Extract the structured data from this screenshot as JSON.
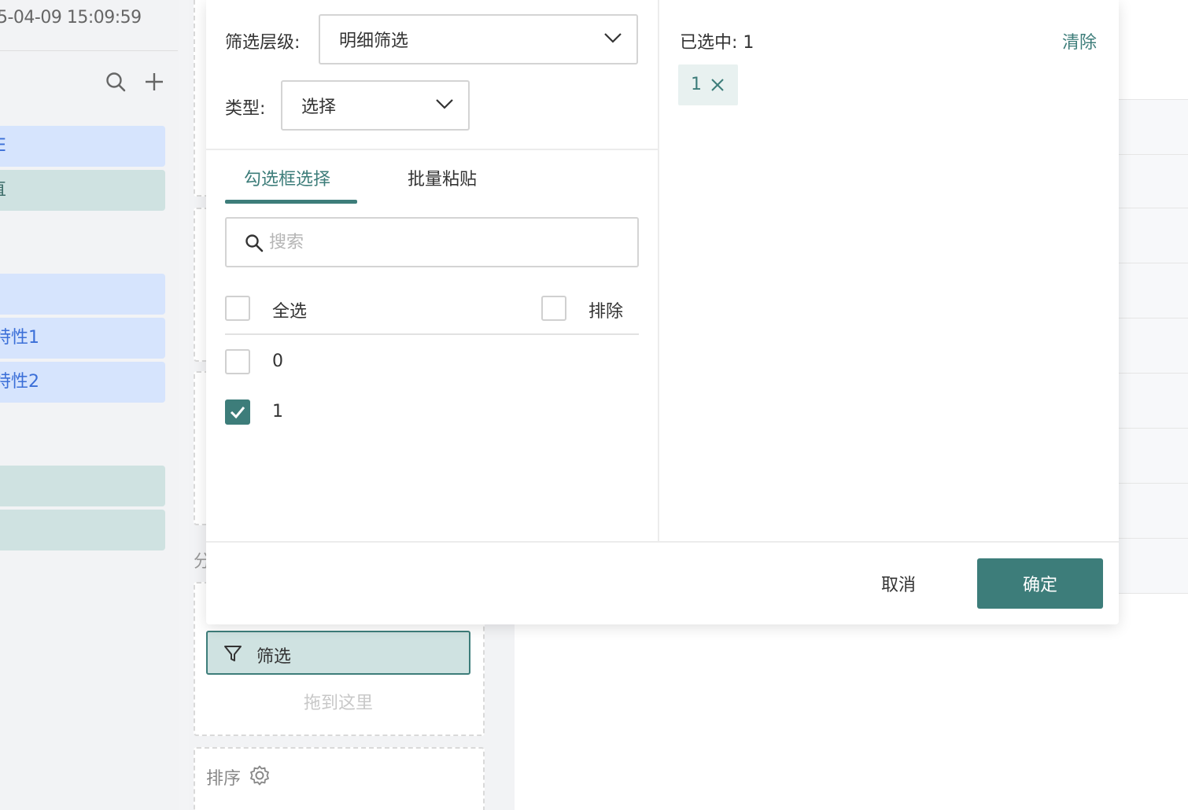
{
  "left_panel": {
    "timestamp": "5-04-09 15:09:59",
    "fields": [
      {
        "label": "E",
        "style": "blue"
      },
      {
        "label": "直",
        "style": "teal"
      },
      {
        "label": "",
        "style": "blue"
      },
      {
        "label": "特性1",
        "style": "blue"
      },
      {
        "label": "特性2",
        "style": "blue"
      },
      {
        "label": "",
        "style": "teal"
      },
      {
        "label": "",
        "style": "teal"
      }
    ]
  },
  "config": {
    "section_label": "分",
    "filter_chip_label": "筛选",
    "drop_hint": "拖到这里",
    "sort_label": "排序"
  },
  "modal": {
    "level_label": "筛选层级:",
    "level_value": "明细筛选",
    "type_label": "类型:",
    "type_value": "选择",
    "tabs": [
      {
        "label": "勾选框选择",
        "active": true
      },
      {
        "label": "批量粘贴",
        "active": false
      }
    ],
    "search_placeholder": "搜索",
    "select_all_label": "全选",
    "exclude_label": "排除",
    "options": [
      {
        "label": "0",
        "checked": false
      },
      {
        "label": "1",
        "checked": true
      }
    ],
    "selected_title": "已选中: 1",
    "clear_label": "清除",
    "selected_tags": [
      "1"
    ],
    "cancel_label": "取消",
    "ok_label": "确定"
  },
  "colors": {
    "accent": "#3d7d7a",
    "field_blue": "#d6e4fd",
    "field_teal": "#cfe2e1"
  }
}
